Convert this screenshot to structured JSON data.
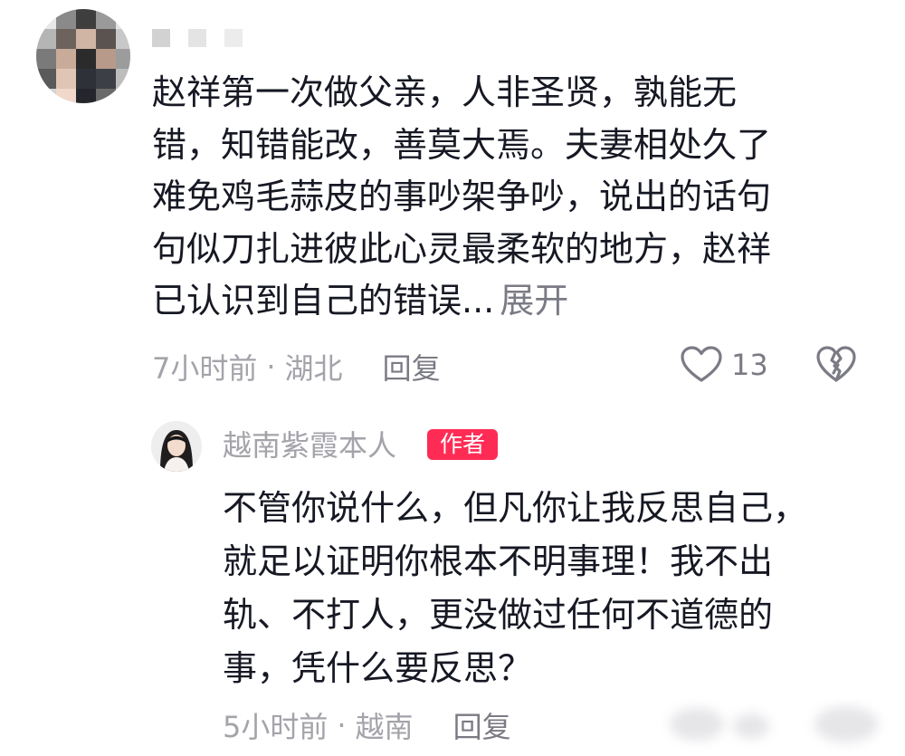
{
  "comment": {
    "avatar_icon": "avatar-pixelated",
    "username_censored": true,
    "text_lines": [
      "赵祥第一次做父亲，人非圣贤，孰能无",
      "错，知错能改，善莫大焉。夫妻相处久了",
      "难免鸡毛蒜皮的事吵架争吵，说出的话句",
      "句似刀扎进彼此心灵最柔软的地方，赵祥",
      "已认识到自己的错误..."
    ],
    "expand_label": "展开",
    "time": "7小时前",
    "separator": "·",
    "location": "湖北",
    "reply_label": "回复",
    "like_count": "13",
    "like_icon": "heart-outline-icon",
    "dislike_icon": "broken-heart-icon"
  },
  "reply": {
    "author_name": "越南紫霞本人",
    "author_badge": "作者",
    "text_lines": [
      "不管你说什么，但凡你让我反思自己，",
      "就足以证明你根本不明事理！我不出",
      "轨、不打人，更没做过任何不道德的",
      "事，凭什么要反思？"
    ],
    "time": "5小时前",
    "separator": "·",
    "location": "越南",
    "reply_label": "回复"
  },
  "colors": {
    "text_primary": "#161823",
    "text_secondary": "#a3a3aa",
    "text_link": "#7b7b85",
    "badge_bg": "#fe2c55"
  }
}
